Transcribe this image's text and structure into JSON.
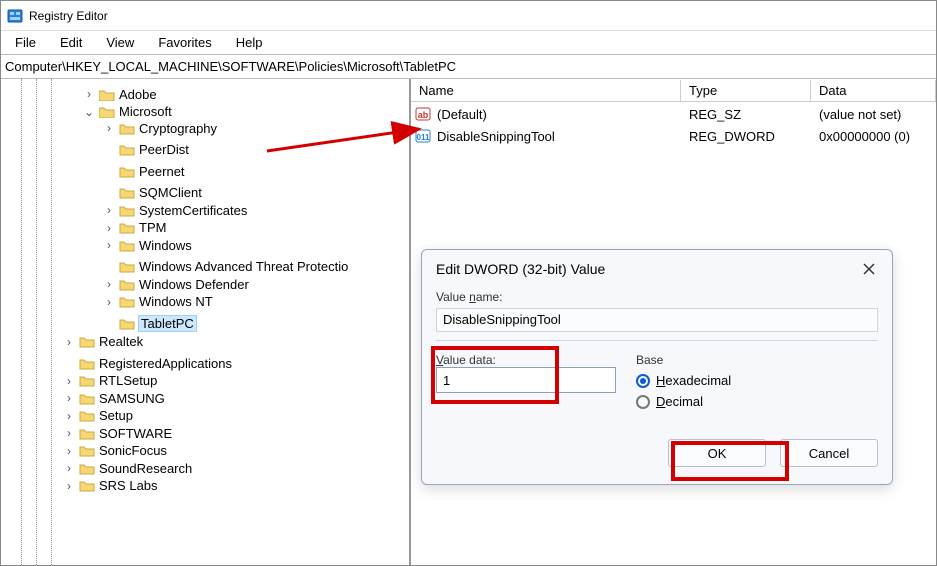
{
  "window": {
    "title": "Registry Editor"
  },
  "menubar": {
    "file": "File",
    "edit": "Edit",
    "view": "View",
    "favorites": "Favorites",
    "help": "Help"
  },
  "address": "Computer\\HKEY_LOCAL_MACHINE\\SOFTWARE\\Policies\\Microsoft\\TabletPC",
  "tree": {
    "adobe": "Adobe",
    "microsoft": "Microsoft",
    "cryptography": "Cryptography",
    "peerdist": "PeerDist",
    "peernet": "Peernet",
    "sqmclient": "SQMClient",
    "systemcertificates": "SystemCertificates",
    "tpm": "TPM",
    "windows": "Windows",
    "watp": "Windows Advanced Threat Protectio",
    "defender": "Windows Defender",
    "winnt": "Windows NT",
    "tabletpc": "TabletPC",
    "realtek": "Realtek",
    "regapps": "RegisteredApplications",
    "rtlsetup": "RTLSetup",
    "samsung": "SAMSUNG",
    "setup": "Setup",
    "software": "SOFTWARE",
    "sonicfocus": "SonicFocus",
    "soundresearch": "SoundResearch",
    "srslabs": "SRS Labs"
  },
  "columns": {
    "name": "Name",
    "type": "Type",
    "data": "Data"
  },
  "values": [
    {
      "name": "(Default)",
      "type": "REG_SZ",
      "data": "(value not set)",
      "icon": "string"
    },
    {
      "name": "DisableSnippingTool",
      "type": "REG_DWORD",
      "data": "0x00000000 (0)",
      "icon": "dword"
    }
  ],
  "dialog": {
    "title": "Edit DWORD (32-bit) Value",
    "valuename_label_pre": "Value ",
    "valuename_label_u": "n",
    "valuename_label_post": "ame:",
    "valuename": "DisableSnippingTool",
    "valuedata_label_pre": "",
    "valuedata_label_u": "V",
    "valuedata_label_post": "alue data:",
    "valuedata": "1",
    "base_label": "Base",
    "hex_label_u": "H",
    "hex_label_post": "exadecimal",
    "dec_label_u": "D",
    "dec_label_post": "ecimal",
    "ok": "OK",
    "cancel": "Cancel"
  }
}
